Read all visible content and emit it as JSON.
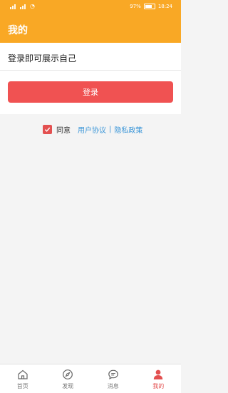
{
  "statusbar": {
    "battery": "97%",
    "time": "18:24"
  },
  "header": {
    "title": "我的"
  },
  "login": {
    "prompt": "登录即可展示自己",
    "button": "登录"
  },
  "agreement": {
    "checked": true,
    "label": "同意",
    "user_agreement": "用户协议",
    "separator": "|",
    "privacy_policy": "隐私政策"
  },
  "tabs": [
    {
      "label": "首页",
      "icon": "home-icon",
      "active": false
    },
    {
      "label": "发现",
      "icon": "compass-icon",
      "active": false
    },
    {
      "label": "消息",
      "icon": "message-icon",
      "active": false
    },
    {
      "label": "我的",
      "icon": "person-icon",
      "active": true
    }
  ],
  "colors": {
    "accent": "#f9a825",
    "button": "#f05252",
    "active_tab": "#e35050",
    "link": "#3b96d8"
  }
}
